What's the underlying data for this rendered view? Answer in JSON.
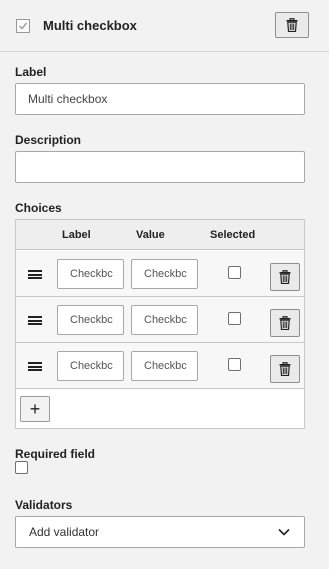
{
  "header": {
    "title": "Multi checkbox",
    "type_icon": "checkbox-icon",
    "delete_icon": "trash-icon"
  },
  "label_field": {
    "label": "Label",
    "value": "Multi checkbox"
  },
  "description_field": {
    "label": "Description",
    "value": ""
  },
  "choices": {
    "label": "Choices",
    "columns": [
      "Label",
      "Value",
      "Selected"
    ],
    "rows": [
      {
        "label": "Checkbc",
        "value": "Checkbc",
        "selected": false
      },
      {
        "label": "Checkbc",
        "value": "Checkbc",
        "selected": false
      },
      {
        "label": "Checkbc",
        "value": "Checkbc",
        "selected": false
      }
    ],
    "add_label": "+"
  },
  "required": {
    "label": "Required field",
    "checked": false
  },
  "validators": {
    "label": "Validators",
    "selected": "Add validator"
  }
}
